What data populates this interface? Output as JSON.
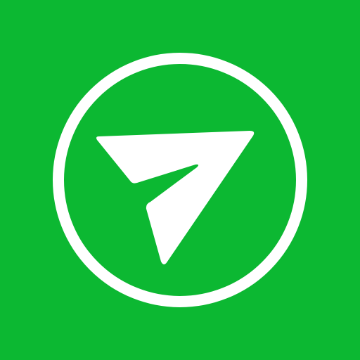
{
  "app_icon": {
    "icon": "paper-plane-send-icon",
    "colors": {
      "background": "#0CB832",
      "foreground": "#FFFFFF"
    }
  }
}
